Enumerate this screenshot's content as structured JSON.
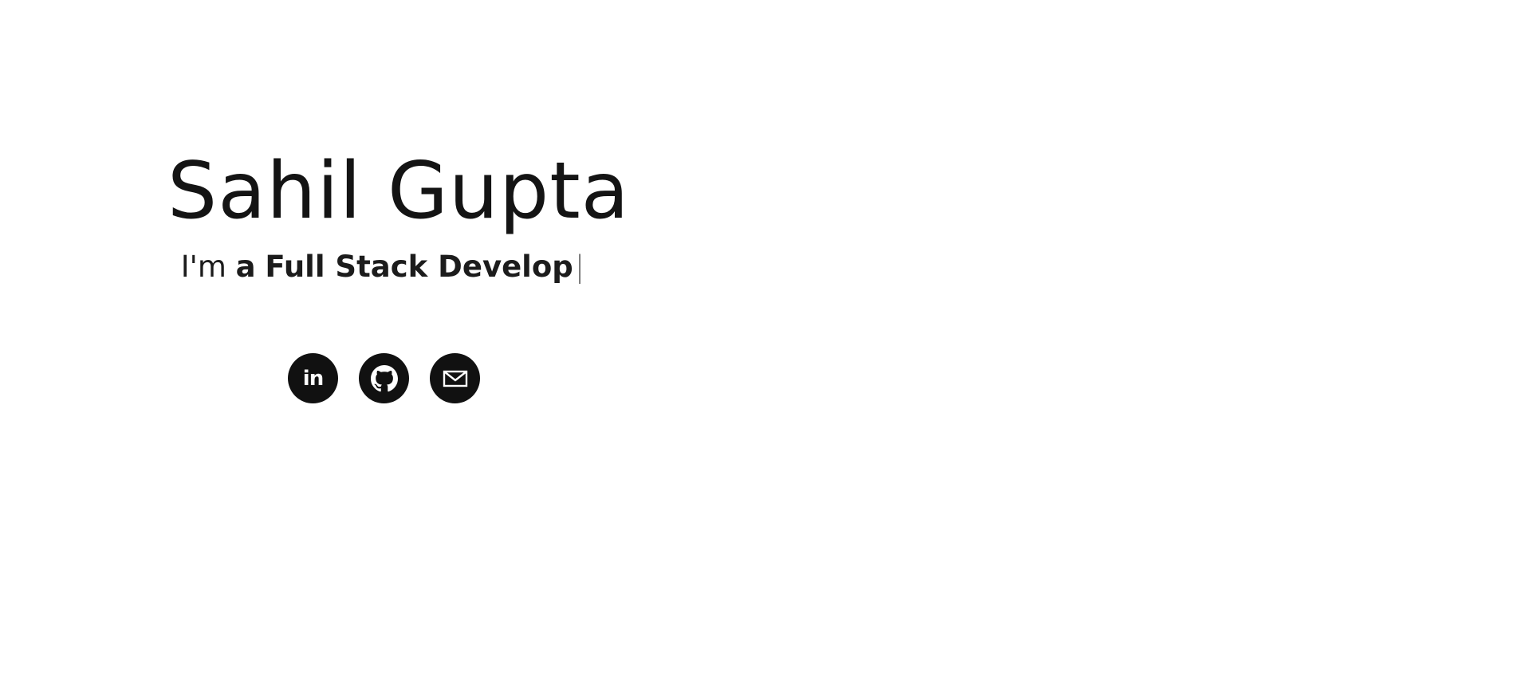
{
  "hero": {
    "name": "Sahil Gupta",
    "tagline_prefix": "I'm",
    "tagline_article": "a",
    "tagline_role": "Full Stack Develop",
    "cursor": "|"
  },
  "socials": [
    {
      "id": "linkedin",
      "icon": "linkedin-icon",
      "glyph": "in"
    },
    {
      "id": "github",
      "icon": "github-icon"
    },
    {
      "id": "email",
      "icon": "mail-icon"
    }
  ],
  "colors": {
    "background": "#ffffff",
    "text": "#141414",
    "icon_bg": "#111111",
    "icon_fg": "#ffffff",
    "cursor": "#6a6a6a"
  }
}
